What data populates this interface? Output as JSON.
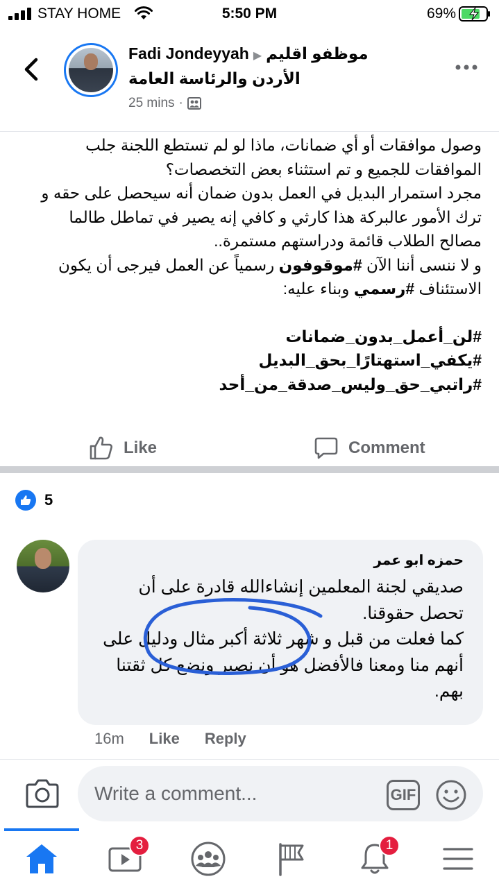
{
  "status_bar": {
    "carrier": "STAY HOME",
    "time": "5:50 PM",
    "battery_percent": "69%",
    "icons": [
      "signal-icon",
      "wifi-icon",
      "battery-charging-icon"
    ]
  },
  "header": {
    "author": "Fadi Jondeyyah",
    "group_line1": "موظفو اقليم",
    "group_line2": "الأردن والرئاسة العامة",
    "time": "25 mins",
    "icons": [
      "back-icon",
      "group-icon",
      "more-icon"
    ]
  },
  "post": {
    "lines": [
      "وصول موافقات أو أي ضمانات، ماذا لو لم تستطع اللجنة جلب الموافقات للجميع و تم استثناء بعض التخصصات؟",
      "مجرد استمرار البديل في العمل بدون ضمان أنه سيحصل على حقه و ترك الأمور عالبركة هذا كارثي و كافي إنه يصير في تماطل طالما مصالح الطلاب قائمة ودراستهم مستمرة.."
    ],
    "line3_part1": "و لا ننسى أننا الآن ",
    "line3_hashtag1": "#موقوفون",
    "line3_part2": " رسمياً عن العمل فيرجى أن يكون الاستئناف ",
    "line3_hashtag2": "#رسمي",
    "line3_part3": " وبناء عليه:",
    "hashtags": [
      "#لن_أعمل_بدون_ضمانات",
      "#يكفي_استهتارًا_بحق_البديل",
      "#راتبي_حق_وليس_صدقة_من_أحد"
    ]
  },
  "actions": {
    "like_label": "Like",
    "comment_label": "Comment"
  },
  "reactions": {
    "count": "5"
  },
  "comment": {
    "author": "حمزه ابو عمر",
    "text_lines": [
      "صديقي لجنة المعلمين إنشاءالله قادرة على أن تحصل حقوقنا.",
      "كما فعلت من قبل و شهر ثلاثة أكبر مثال ودليل على أنهم منا ومعنا فالأفضل هو أن نصبر ونضع كل ثقتنا بهم."
    ],
    "time": "16m",
    "like_label": "Like",
    "reply_label": "Reply"
  },
  "composer": {
    "placeholder": "Write a comment...",
    "gif_label": "GIF"
  },
  "nav": {
    "items": [
      "home-icon",
      "watch-icon",
      "groups-icon",
      "pages-icon",
      "notifications-icon",
      "menu-icon"
    ],
    "watch_badge": "3",
    "notifications_badge": "1",
    "accent": "#1877f2"
  }
}
